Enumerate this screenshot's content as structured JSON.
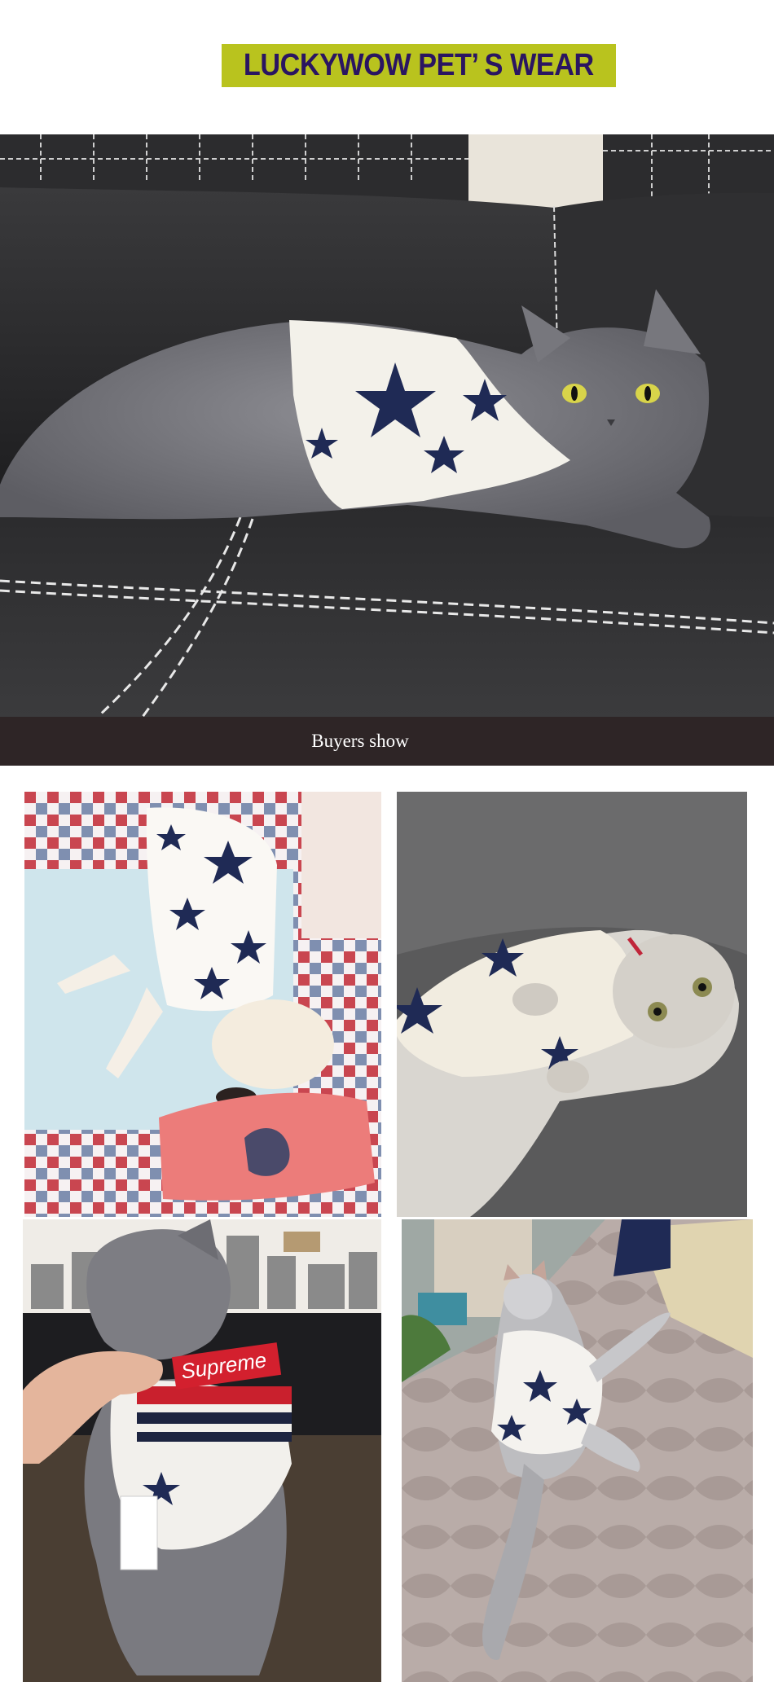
{
  "header": {
    "brand_title": "LUCKYWOW PET’ S  WEAR"
  },
  "caption": {
    "label": "Buyers show"
  },
  "photos": {
    "hero": "grey-cat-in-star-shirt-on-leather-sofa",
    "buyer_1": "white-dog-in-star-shirt-on-checked-blanket",
    "buyer_2": "tabby-cat-in-star-shirt-on-grey-couch",
    "buyer_3": "grey-cat-in-striped-shirt",
    "buyer_4": "grey-cat-in-star-shirt-on-rug"
  },
  "buyer_3_tag_text": "Supreme",
  "colors": {
    "banner": "#b9c31e",
    "brand_text": "#2a1561",
    "caption_bar": "#2e2526",
    "caption_text": "#ffffff"
  }
}
